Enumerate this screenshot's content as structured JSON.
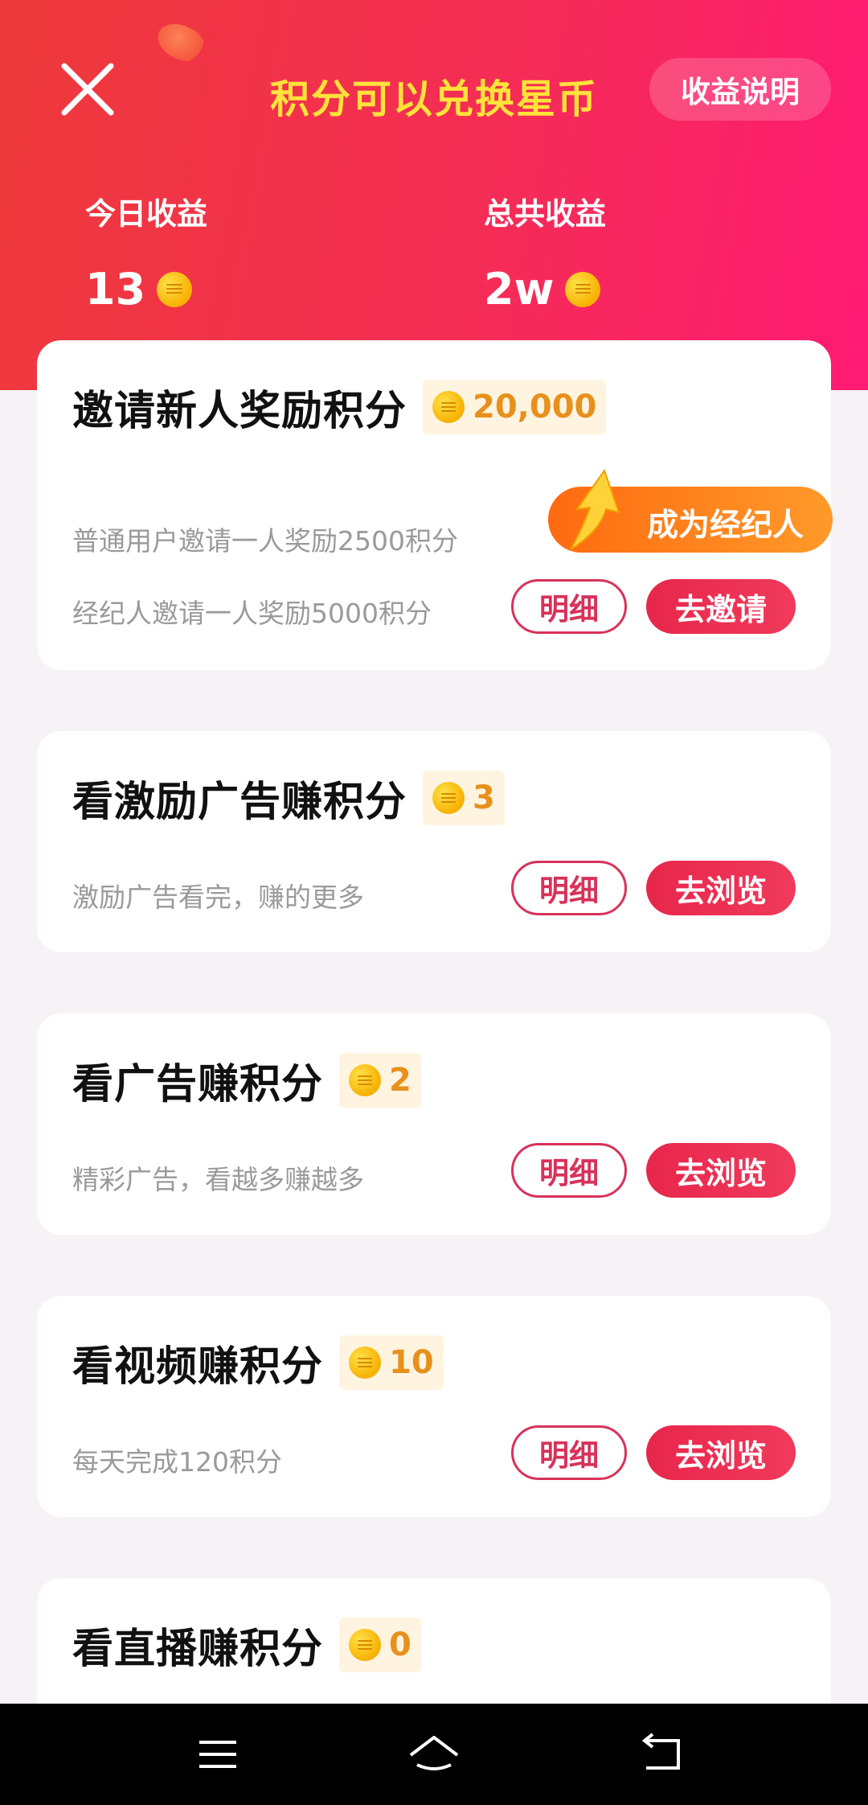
{
  "header": {
    "title": "积分可以兑换星币",
    "explain_label": "收益说明",
    "today": {
      "label": "今日收益",
      "value": "13"
    },
    "total": {
      "label": "总共收益",
      "value": "2w"
    }
  },
  "cards": [
    {
      "title": "邀请新人奖励积分",
      "reward": "20,000",
      "desc_lines": [
        "普通用户邀请一人奖励2500积分",
        "经纪人邀请一人奖励5000积分"
      ],
      "agent_label": "成为经纪人",
      "detail_label": "明细",
      "action_label": "去邀请"
    },
    {
      "title": "看激励广告赚积分",
      "reward": "3",
      "desc": "激励广告看完，赚的更多",
      "detail_label": "明细",
      "action_label": "去浏览"
    },
    {
      "title": "看广告赚积分",
      "reward": "2",
      "desc": "精彩广告，看越多赚越多",
      "detail_label": "明细",
      "action_label": "去浏览"
    },
    {
      "title": "看视频赚积分",
      "reward": "10",
      "desc": "每天完成120积分",
      "detail_label": "明细",
      "action_label": "去浏览"
    },
    {
      "title": "看直播赚积分",
      "reward": "0"
    }
  ],
  "icons": {
    "close": "close-icon",
    "coin": "coin-icon",
    "arrow": "arrow-up-icon",
    "nav_menu": "menu-icon",
    "nav_home": "home-icon",
    "nav_back": "back-icon"
  },
  "colors": {
    "header_start": "#ee3a3a",
    "header_end": "#ff1a73",
    "title_yellow": "#ffe23a",
    "accent": "#e8264b",
    "reward_text": "#e8901c",
    "agent_orange": "#ff7a18"
  }
}
